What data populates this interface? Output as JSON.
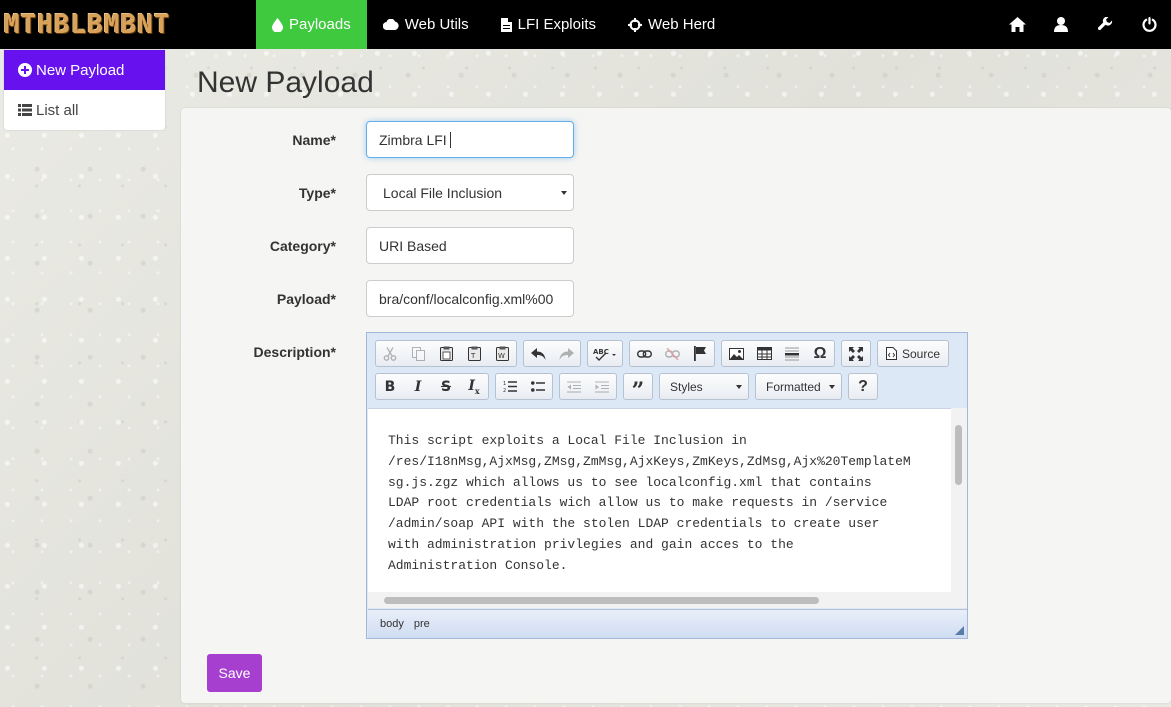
{
  "brand": "MTHBLBMBNT",
  "nav": {
    "items": [
      {
        "label": "Payloads",
        "icon": "droplet-icon"
      },
      {
        "label": "Web Utils",
        "icon": "cloud-icon"
      },
      {
        "label": "LFI Exploits",
        "icon": "file-icon"
      },
      {
        "label": "Web Herd",
        "icon": "crosshair-icon"
      }
    ],
    "right_icons": [
      "home-icon",
      "user-icon",
      "wrench-icon",
      "power-icon"
    ],
    "active_color": "#3ec93e"
  },
  "sidebar": {
    "items": [
      {
        "label": "New Payload",
        "icon": "plus-circle-icon"
      },
      {
        "label": "List all",
        "icon": "list-icon"
      }
    ],
    "active_color": "#6611ee"
  },
  "page": {
    "title": "New Payload"
  },
  "form": {
    "name_label": "Name*",
    "name_value": "Zimbra LFI",
    "type_label": "Type*",
    "type_value": "Local File Inclusion",
    "category_label": "Category*",
    "category_value": "URI Based",
    "payload_label": "Payload*",
    "payload_value": "bra/conf/localconfig.xml%00",
    "description_label": "Description*",
    "description_value": "This script exploits a Local File Inclusion in\n/res/I18nMsg,AjxMsg,ZMsg,ZmMsg,AjxKeys,ZmKeys,ZdMsg,Ajx%20TemplateM\nsg.js.zgz which allows us to see localconfig.xml that contains\nLDAP root credentials wich allow us to make requests in /service\n/admin/soap API with the stolen LDAP credentials to create user\nwith administration privlegies and gain acces to the\nAdministration Console.",
    "save_label": "Save",
    "save_color": "#a63fcf"
  },
  "editor": {
    "source_label": "Source",
    "styles_label": "Styles",
    "format_label": "Formatted",
    "help_label": "?",
    "path": [
      "body",
      "pre"
    ]
  }
}
